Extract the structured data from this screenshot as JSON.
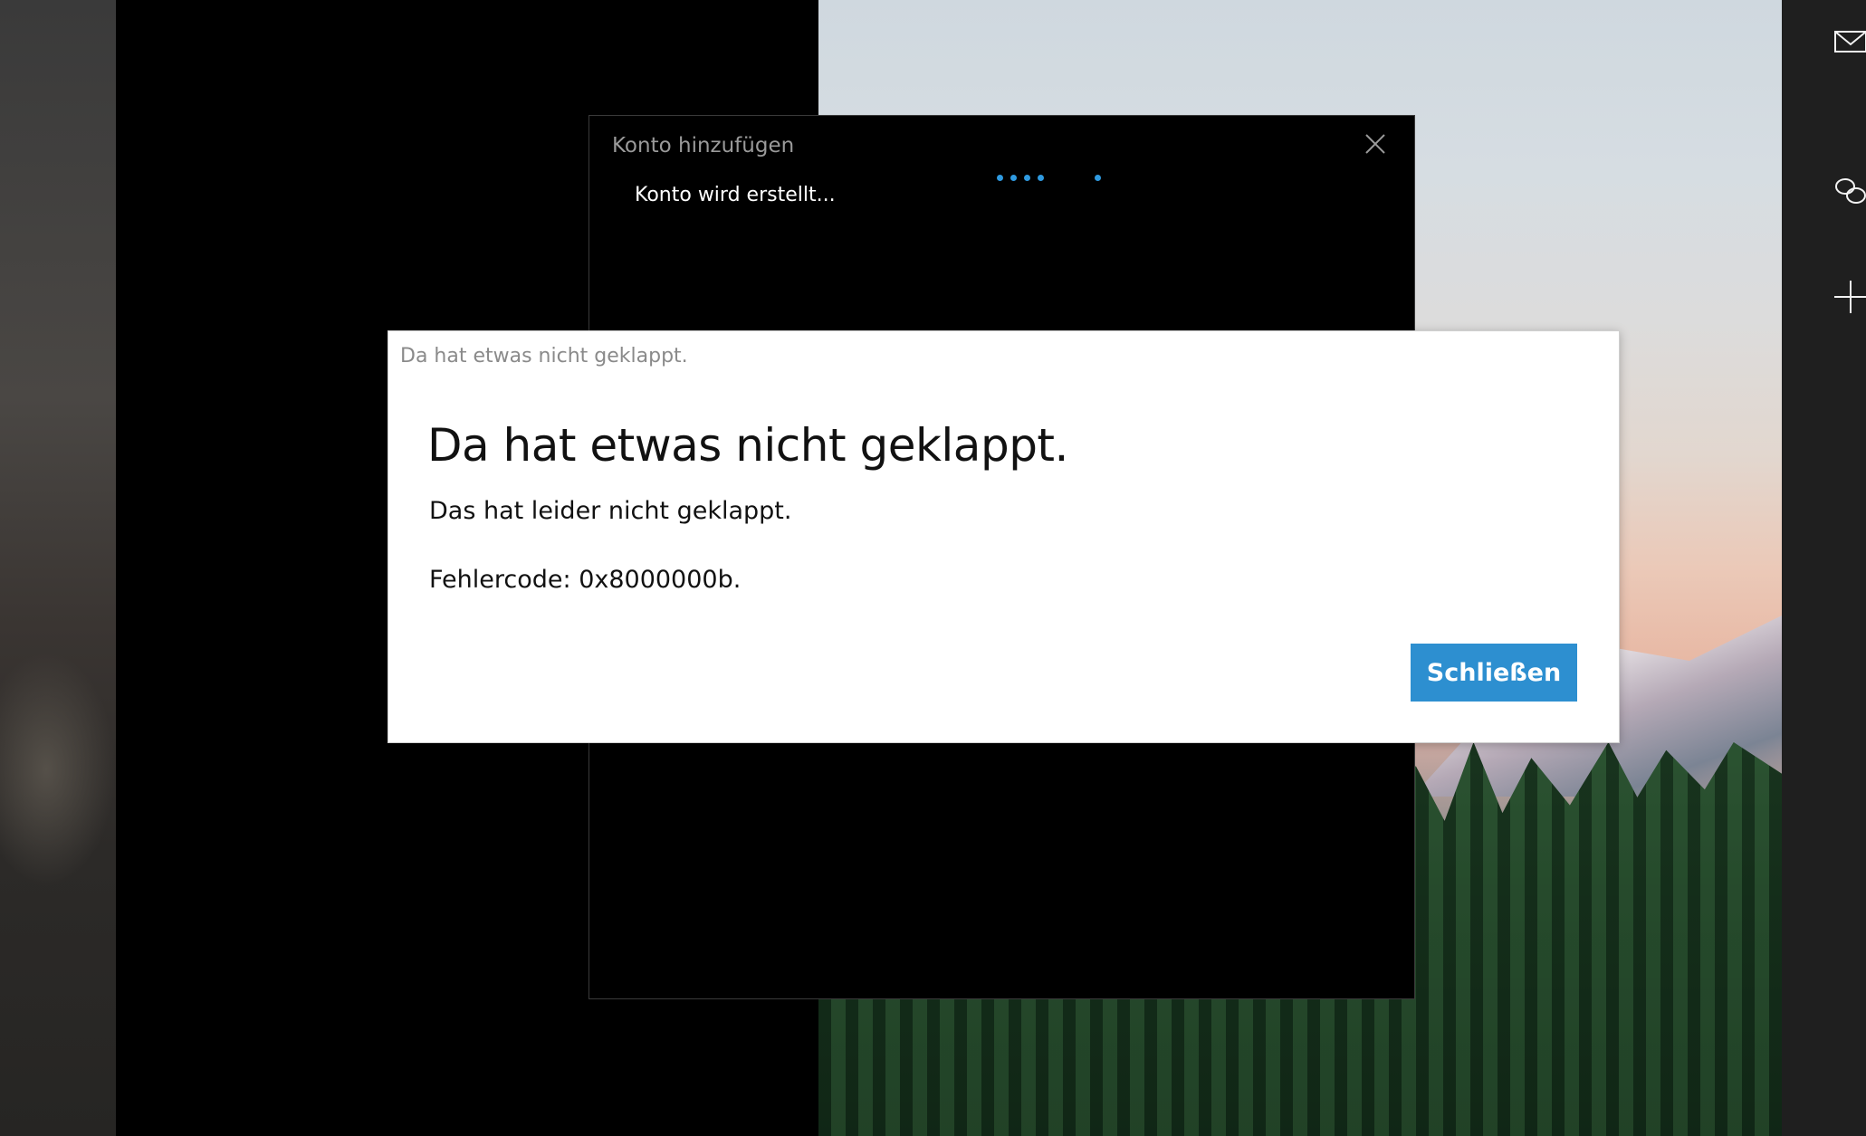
{
  "account_window": {
    "title": "Konto hinzufügen",
    "status": "Konto wird erstellt...",
    "close_icon": "close-icon"
  },
  "error_dialog": {
    "caption": "Da hat etwas nicht geklappt.",
    "heading": "Da hat etwas nicht geklappt.",
    "message": "Das hat leider nicht geklappt.",
    "error_code": "Fehlercode: 0x8000000b.",
    "close_button_label": "Schließen",
    "accent_color": "#2d8fd0"
  },
  "sidebar_icons": [
    "mail-icon",
    "link-icon",
    "add-icon"
  ]
}
